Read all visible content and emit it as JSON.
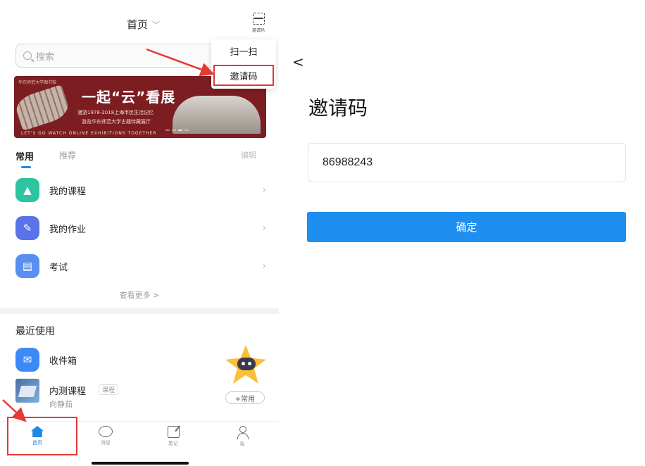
{
  "left": {
    "topbar": {
      "title": "首页",
      "chevron": "﹀",
      "scan_label": "邀请码"
    },
    "search": {
      "placeholder": "搜索"
    },
    "popup": {
      "items": [
        "扫一扫",
        "邀请码"
      ]
    },
    "banner": {
      "logo_text": "华东师范大学图书馆",
      "title": "一起“云”看展",
      "sub1": "漫游1978-2018上海市民生活记忆",
      "sub2": "游览华东师范大学古籍特藏展厅",
      "footer": "LET'S GO WATCH ONLINE EXHIBITIONS TOGETHER"
    },
    "tabs": {
      "common": "常用",
      "recommend": "推荐",
      "edit": "编辑"
    },
    "common_items": [
      {
        "label": "我的课程",
        "icon": "graduation-cap-icon",
        "color": "#2ec4a0"
      },
      {
        "label": "我的作业",
        "icon": "homework-icon",
        "color": "#5a73e8"
      },
      {
        "label": "考试",
        "icon": "exam-icon",
        "color": "#5a8ff0"
      }
    ],
    "more": "查看更多 >",
    "recent": {
      "title": "最近使用",
      "inbox": {
        "label": "收件箱",
        "color": "#3d8af7"
      },
      "course": {
        "name": "内测课程",
        "tag": "课程",
        "teacher": "向静茹"
      }
    },
    "add_common": "+常用",
    "tabbar": {
      "home": "首页",
      "message": "消息",
      "note": "笔记",
      "me": "我"
    },
    "accent": "#1e88e5",
    "highlight_color": "#e53935"
  },
  "right": {
    "back": "<",
    "title": "邀请码",
    "code": "86988243",
    "confirm": "确定",
    "button_color": "#1e8ff0"
  }
}
